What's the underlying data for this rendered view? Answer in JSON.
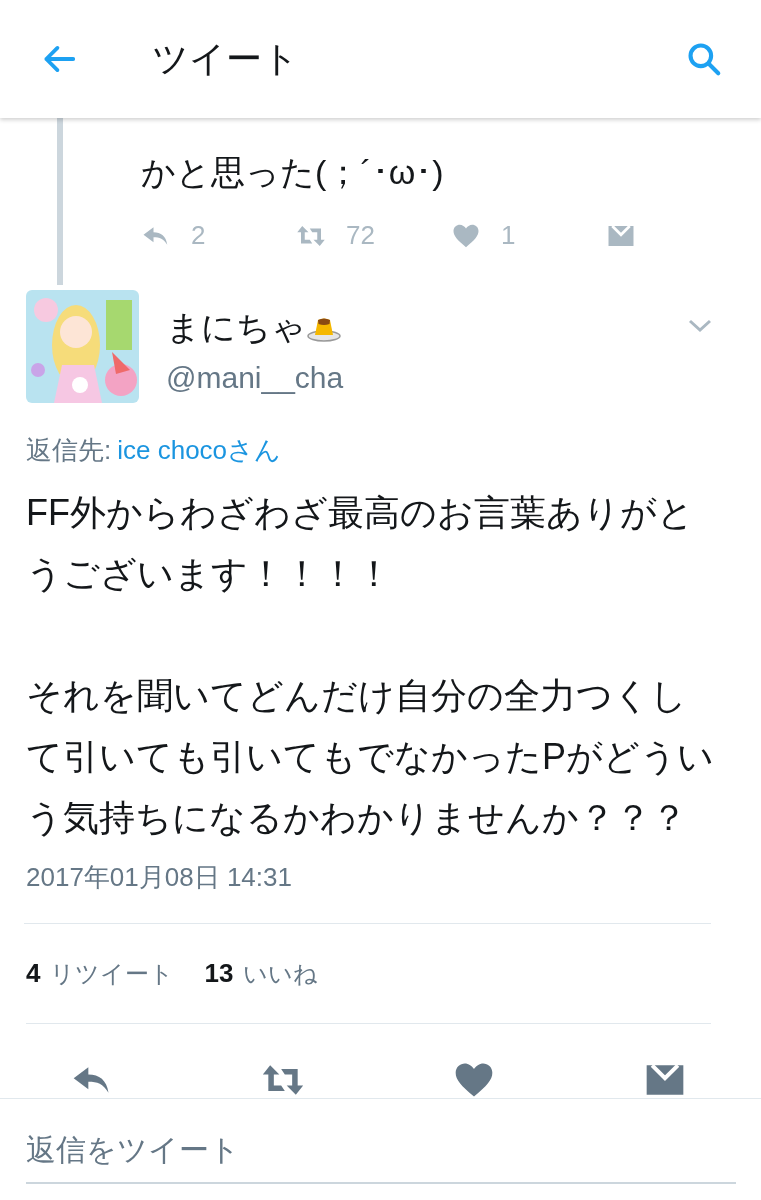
{
  "header": {
    "title": "ツイート"
  },
  "previous_tweet": {
    "text": "かと思った(；´･ω･)",
    "actions": [
      {
        "kind": "reply",
        "count": "2"
      },
      {
        "kind": "retweet",
        "count": "72"
      },
      {
        "kind": "like",
        "count": "1"
      },
      {
        "kind": "message"
      }
    ]
  },
  "tweet": {
    "name": "まにちゃ",
    "handle": "@mani__cha",
    "reply_label": "返信先:",
    "reply_to": "ice chocoさん",
    "paragraphs": [
      "FF外からわざわざ最高のお言葉ありがとうございます！！！！",
      "それを聞いてどんだけ自分の全力つくして引いても引いてもでなかったPがどういう気持ちになるかわかりませんか？？？"
    ],
    "timestamp": "2017年01月08日 14:31",
    "stats": [
      {
        "count": "4",
        "label": "リツイート"
      },
      {
        "count": "13",
        "label": "いいね"
      }
    ],
    "actions": [
      {
        "kind": "reply"
      },
      {
        "kind": "retweet"
      },
      {
        "kind": "like"
      },
      {
        "kind": "message"
      }
    ]
  },
  "compose": {
    "placeholder": "返信をツイート"
  }
}
